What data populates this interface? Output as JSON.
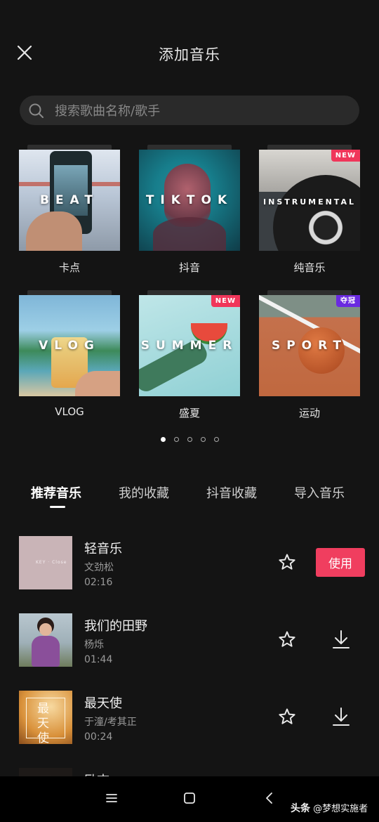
{
  "header": {
    "title": "添加音乐"
  },
  "search": {
    "placeholder": "搜索歌曲名称/歌手"
  },
  "categories": [
    {
      "label": "卡点",
      "cover_word": "BEAT"
    },
    {
      "label": "抖音",
      "cover_word": "TIKTOK"
    },
    {
      "label": "纯音乐",
      "cover_word": "INSTRUMENTAL",
      "badge": "NEW"
    },
    {
      "label": "VLOG",
      "cover_word": "VLOG"
    },
    {
      "label": "盛夏",
      "cover_word": "SUMMER",
      "badge": "NEW"
    },
    {
      "label": "运动",
      "cover_word": "SPORT",
      "badge": "夺冠"
    }
  ],
  "pagination": {
    "total": 5,
    "current": 1
  },
  "tabs": [
    {
      "label": "推荐音乐",
      "active": true
    },
    {
      "label": "我的收藏",
      "active": false
    },
    {
      "label": "抖音收藏",
      "active": false
    },
    {
      "label": "导入音乐",
      "active": false
    }
  ],
  "songs": [
    {
      "name": "轻音乐",
      "artist": "文劲松",
      "duration": "02:16",
      "action": "使用"
    },
    {
      "name": "我们的田野",
      "artist": "杨烁",
      "duration": "01:44"
    },
    {
      "name": "最天使",
      "artist": "于潼/考其正",
      "duration": "00:24",
      "cover_text": "最天使"
    },
    {
      "name": "励志"
    }
  ],
  "watermark": {
    "source": "头条",
    "author": "@梦想实施者"
  },
  "colors": {
    "accent": "#f03e5f",
    "background": "#141414",
    "badge_new": "#f0365a",
    "badge_champion": "#6a2ae0"
  },
  "icons": [
    "close-icon",
    "search-icon",
    "star-icon",
    "download-icon",
    "menu-icon",
    "home-icon",
    "back-icon"
  ]
}
